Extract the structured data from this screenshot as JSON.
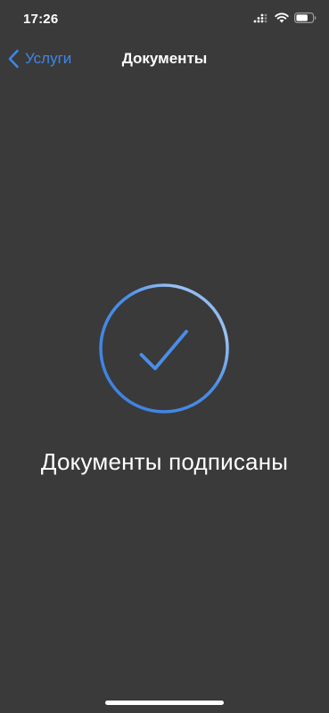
{
  "status_bar": {
    "time": "17:26",
    "icons": [
      "cellular-signal-icon",
      "wifi-icon",
      "battery-icon"
    ]
  },
  "nav": {
    "back_label": "Услуги",
    "title": "Документы"
  },
  "main": {
    "status_icon": "checkmark-circle-icon",
    "message": "Документы подписаны"
  },
  "colors": {
    "background": "#3a3a3a",
    "accent": "#3e86e6",
    "text": "#ffffff"
  }
}
